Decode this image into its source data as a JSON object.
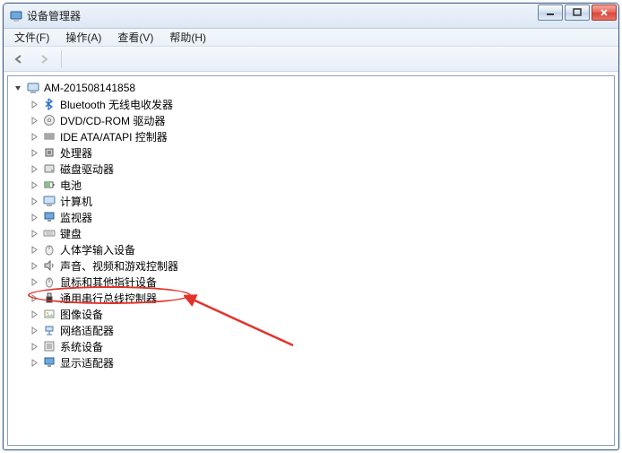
{
  "window": {
    "title": "设备管理器"
  },
  "menu": {
    "file": "文件(F)",
    "action": "操作(A)",
    "view": "查看(V)",
    "help": "帮助(H)"
  },
  "toolbar": {
    "back": "back",
    "fwd": "forward"
  },
  "tree": {
    "root": "AM-201508141858",
    "nodes": [
      {
        "label": "Bluetooth 无线电收发器",
        "icon": "bluetooth"
      },
      {
        "label": "DVD/CD-ROM 驱动器",
        "icon": "cdrom"
      },
      {
        "label": "IDE ATA/ATAPI 控制器",
        "icon": "ide"
      },
      {
        "label": "处理器",
        "icon": "cpu"
      },
      {
        "label": "磁盘驱动器",
        "icon": "disk"
      },
      {
        "label": "电池",
        "icon": "battery"
      },
      {
        "label": "计算机",
        "icon": "computer"
      },
      {
        "label": "监视器",
        "icon": "monitor"
      },
      {
        "label": "键盘",
        "icon": "keyboard"
      },
      {
        "label": "人体学输入设备",
        "icon": "hid"
      },
      {
        "label": "声音、视频和游戏控制器",
        "icon": "sound"
      },
      {
        "label": "鼠标和其他指针设备",
        "icon": "mouse"
      },
      {
        "label": "通用串行总线控制器",
        "icon": "usb",
        "highlighted": true
      },
      {
        "label": "图像设备",
        "icon": "image"
      },
      {
        "label": "网络适配器",
        "icon": "network"
      },
      {
        "label": "系统设备",
        "icon": "system"
      },
      {
        "label": "显示适配器",
        "icon": "display"
      }
    ]
  }
}
